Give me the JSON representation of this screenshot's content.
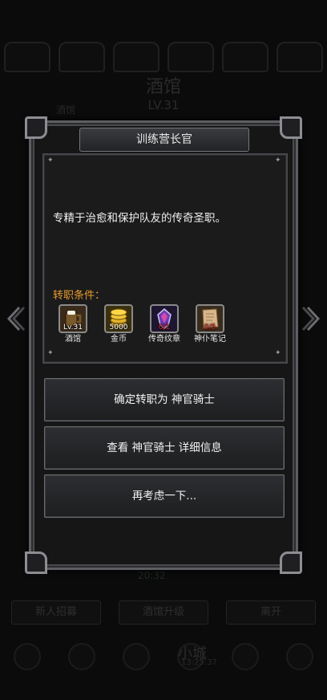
{
  "background": {
    "title": "酒馆",
    "title_sub": "LV.31",
    "left_label": "酒馆",
    "status": "20:32",
    "buttons": [
      "新人招募",
      "酒馆升级",
      "离开"
    ],
    "bottom_label": "小城",
    "bottom_time": "13:25:37"
  },
  "dialog": {
    "title": "训练营长官",
    "description": "专精于治愈和保护队友的传奇圣职。",
    "requirements_label": "转职条件：",
    "requirements": [
      {
        "icon": "tavern-icon",
        "overlay": "Lv.31",
        "overlay_color": "#ffffff",
        "name": "酒馆"
      },
      {
        "icon": "gold-coins-icon",
        "overlay": "5000",
        "overlay_color": "#ffffff",
        "name": "金币"
      },
      {
        "icon": "legend-emblem-icon",
        "overlay": "0/1",
        "overlay_color": "#e02020",
        "name": "传奇纹章"
      },
      {
        "icon": "parchment-icon",
        "overlay": "0/5",
        "overlay_color": "#e02020",
        "name": "神仆笔记"
      }
    ],
    "buttons": {
      "confirm": "确定转职为 神官骑士",
      "details": "查看 神官骑士 详细信息",
      "reconsider": "再考虑一下..."
    }
  },
  "colors": {
    "accent_orange": "#e89a2c",
    "insufficient_red": "#e02020",
    "frame_gray": "#5d5e62"
  }
}
